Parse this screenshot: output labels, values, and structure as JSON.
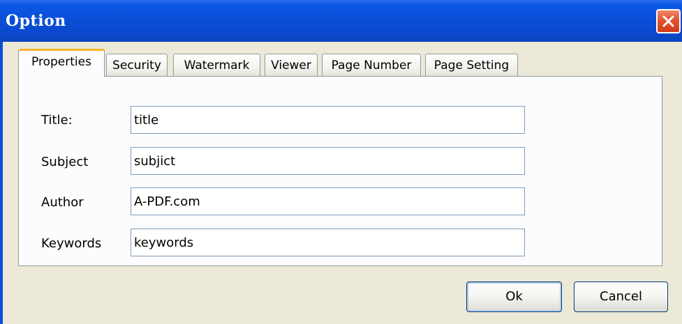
{
  "window": {
    "title": "Option"
  },
  "tabs": [
    {
      "label": "Properties",
      "active": true
    },
    {
      "label": "Security",
      "active": false
    },
    {
      "label": "Watermark",
      "active": false
    },
    {
      "label": "Viewer",
      "active": false
    },
    {
      "label": "Page Number",
      "active": false
    },
    {
      "label": "Page Setting",
      "active": false
    }
  ],
  "fields": {
    "title": {
      "label": "Title:",
      "value": "title"
    },
    "subject": {
      "label": "Subject",
      "value": "subjict"
    },
    "author": {
      "label": "Author",
      "value": "A-PDF.com"
    },
    "keywords": {
      "label": "Keywords",
      "value": "keywords"
    }
  },
  "buttons": {
    "ok": "Ok",
    "cancel": "Cancel"
  },
  "icons": {
    "close": "close-icon"
  }
}
